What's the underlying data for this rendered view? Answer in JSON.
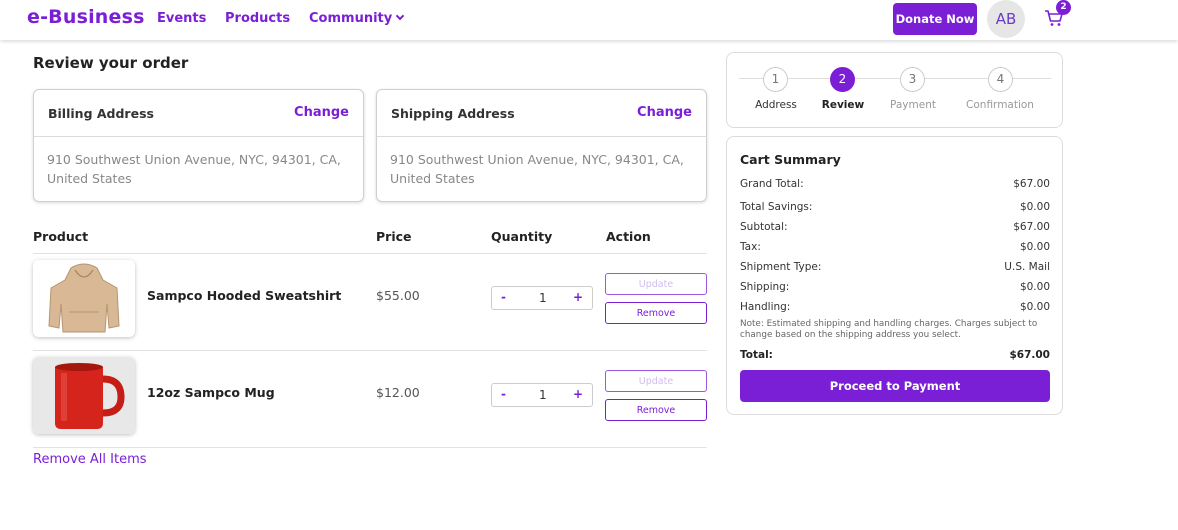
{
  "header": {
    "logo": "e-Business",
    "nav": [
      "Events",
      "Products",
      "Community"
    ],
    "donate_label": "Donate Now",
    "avatar_initials": "AB",
    "cart_count": "2"
  },
  "page_title": "Review your order",
  "billing": {
    "title": "Billing Address",
    "change_label": "Change",
    "address": "910 Southwest Union Avenue, NYC, 94301, CA, United States"
  },
  "shipping": {
    "title": "Shipping Address",
    "change_label": "Change",
    "address": "910 Southwest Union Avenue, NYC, 94301, CA, United States"
  },
  "table": {
    "headers": [
      "Product",
      "Price",
      "Quantity",
      "Action"
    ],
    "rows": [
      {
        "name": "Sampco Hooded Sweatshirt",
        "price": "$55.00",
        "qty": "1",
        "minus": "-",
        "plus": "+",
        "update_label": "Update",
        "remove_label": "Remove"
      },
      {
        "name": "12oz Sampco Mug",
        "price": "$12.00",
        "qty": "1",
        "minus": "-",
        "plus": "+",
        "update_label": "Update",
        "remove_label": "Remove"
      }
    ],
    "remove_all_label": "Remove All Items"
  },
  "steps": [
    {
      "num": "1",
      "label": "Address"
    },
    {
      "num": "2",
      "label": "Review"
    },
    {
      "num": "3",
      "label": "Payment"
    },
    {
      "num": "4",
      "label": "Confirmation"
    }
  ],
  "summary": {
    "title": "Cart Summary",
    "rows": [
      {
        "label": "Grand Total:",
        "value": "$67.00"
      },
      {
        "label": "Total Savings:",
        "value": "$0.00"
      },
      {
        "label": "Subtotal:",
        "value": "$67.00"
      },
      {
        "label": "Tax:",
        "value": "$0.00"
      },
      {
        "label": "Shipment Type:",
        "value": "U.S. Mail"
      },
      {
        "label": "Shipping:",
        "value": "$0.00"
      },
      {
        "label": "Handling:",
        "value": "$0.00"
      }
    ],
    "note": "Note: Estimated shipping and handling charges. Charges subject to change based on the shipping address you select.",
    "total_label": "Total:",
    "total_value": "$67.00",
    "pay_label": "Proceed to Payment"
  },
  "colors": {
    "accent": "#7b1fd6"
  }
}
